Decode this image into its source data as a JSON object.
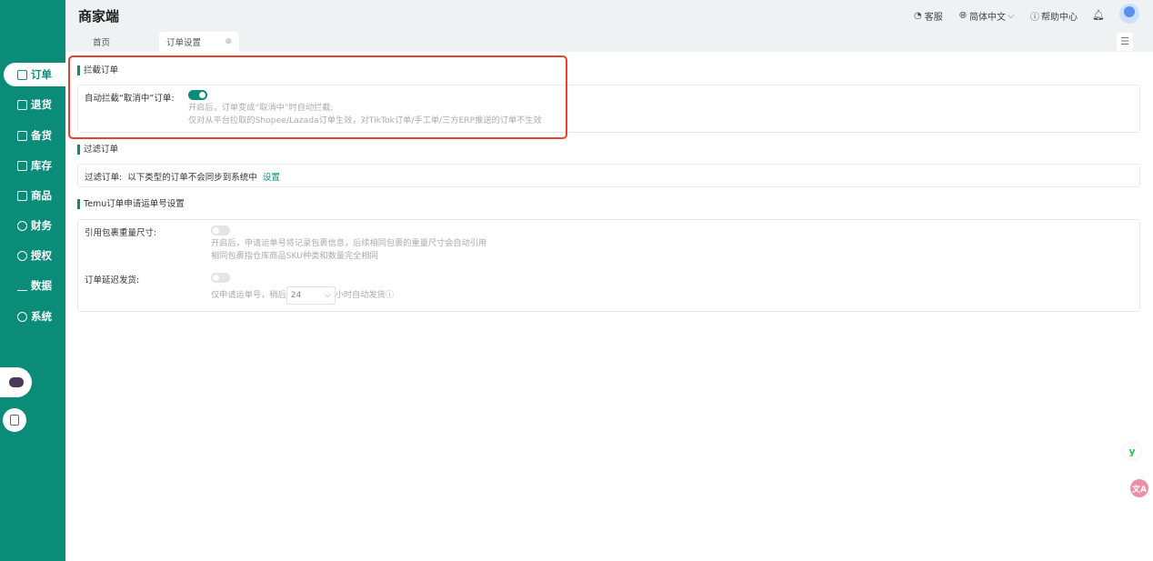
{
  "app": {
    "title": "商家端"
  },
  "header": {
    "service": "客服",
    "language": "简体中文",
    "help": "帮助中心"
  },
  "tabs": [
    {
      "label": "首页"
    },
    {
      "label": "订单设置"
    }
  ],
  "sidebar": {
    "items": [
      {
        "label": "订单"
      },
      {
        "label": "退货"
      },
      {
        "label": "备货"
      },
      {
        "label": "库存"
      },
      {
        "label": "商品"
      },
      {
        "label": "财务"
      },
      {
        "label": "授权"
      },
      {
        "label": "数据"
      },
      {
        "label": "系统"
      }
    ]
  },
  "intercept": {
    "title": "拦截订单",
    "label": "自动拦截“取消中”订单:",
    "enabled": true,
    "hint1": "开启后，订单变成“取消中”时自动拦截;",
    "hint2": "仅对从平台拉取的Shopee/Lazada订单生效，对TikTok订单/手工单/三方ERP推送的订单不生效"
  },
  "filter": {
    "title": "过滤订单",
    "label": "过滤订单:",
    "text": "以下类型的订单不会同步到系统中",
    "link": "设置"
  },
  "temu": {
    "title": "Temu订单申请运单号设置",
    "ref": {
      "label": "引用包裹重量尺寸:",
      "enabled": false,
      "hint1": "开启后，申请运单号将记录包裹信息，后续相同包裹的重量尺寸会自动引用",
      "hint2": "相同包裹指仓库商品SKU种类和数量完全相同"
    },
    "delay": {
      "label": "订单延迟发货:",
      "enabled": false,
      "prefix": "仅申请运单号，稍后",
      "hours": "24",
      "suffix": "小时自动发货"
    }
  },
  "colors": {
    "brand": "#0a8c78",
    "highlight": "#e8412c"
  }
}
